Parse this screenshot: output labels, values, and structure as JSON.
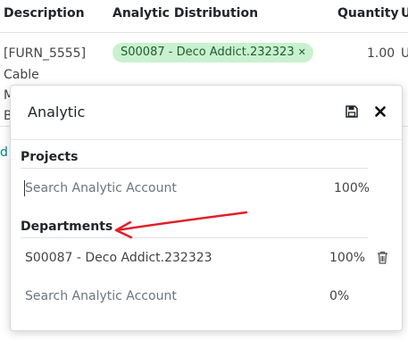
{
  "table": {
    "headers": {
      "description": "Description",
      "analytic": "Analytic Distribution",
      "quantity": "Quantity",
      "uom": "U"
    },
    "row": {
      "description_lines": [
        "[FURN_5555]",
        "Cable",
        "M",
        "B"
      ],
      "analytic_tag": "S00087 - Deco Addict.232323",
      "quantity": "1.00",
      "uom": "U"
    },
    "link_fragment": "d"
  },
  "popover": {
    "title": "Analytic",
    "save_icon": "floppy-disk-icon",
    "close_icon": "close-icon",
    "projects": {
      "title": "Projects",
      "search_placeholder": "Search Analytic Account",
      "percentage": "100%"
    },
    "departments": {
      "title": "Departments",
      "lines": [
        {
          "account": "S00087 - Deco Addict.232323",
          "percentage": "100%"
        }
      ],
      "search_placeholder": "Search Analytic Account",
      "percentage": "0%"
    }
  },
  "annotation": {
    "color": "#e0202b"
  }
}
